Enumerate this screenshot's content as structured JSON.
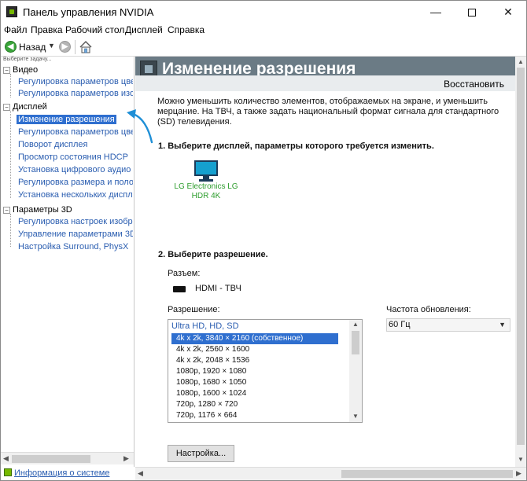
{
  "window": {
    "title": "Панель управления NVIDIA",
    "minimize_glyph": "—",
    "close_glyph": "✕"
  },
  "menu": [
    "Файл",
    "Правка",
    "Рабочий стол",
    "Дисплей",
    "Справка"
  ],
  "toolbar": {
    "back_label": "Назад",
    "back_glyph": "◀",
    "forward_glyph": "▶",
    "dropdown_glyph": "▼"
  },
  "sidebar": {
    "task_hint": "Выберите задачу...",
    "categories": [
      {
        "label": "Видео",
        "expand_glyph": "−",
        "items": [
          "Регулировка параметров цвета",
          "Регулировка параметров изображения"
        ]
      },
      {
        "label": "Дисплей",
        "expand_glyph": "−",
        "items": [
          "Изменение разрешения",
          "Регулировка параметров цвета",
          "Поворот дисплея",
          "Просмотр состояния HDCP",
          "Установка цифрового аудио",
          "Регулировка размера и положения",
          "Установка нескольких дисплеев"
        ]
      },
      {
        "label": "Параметры 3D",
        "expand_glyph": "−",
        "items": [
          "Регулировка настроек изображения",
          "Управление параметрами 3D",
          "Настройка Surround, PhysX"
        ]
      }
    ],
    "selected_item": "Изменение разрешения",
    "system_info": "Информация о системе",
    "scroll_left_glyph": "◀",
    "scroll_right_glyph": "▶"
  },
  "main": {
    "title": "Изменение разрешения",
    "restore_link": "Восстановить",
    "description": "Можно уменьшить количество элементов, отображаемых на экране, и уменьшить мерцание. На ТВЧ, а также задать национальный формат сигнала для стандартного (SD) телевидения.",
    "step1": "1. Выберите дисплей, параметры которого требуется изменить.",
    "display_name_line1": "LG Electronics LG",
    "display_name_line2": "HDR 4K",
    "step2": "2. Выберите разрешение.",
    "connector_label": "Разъем:",
    "connector_value": "HDMI - ТВЧ",
    "resolution_label": "Разрешение:",
    "refresh_label": "Частота обновления:",
    "refresh_value": "60 Гц",
    "resolution_group": "Ultra HD, HD, SD",
    "resolutions": [
      "4k x 2k, 3840 × 2160 (собственное)",
      "4k x 2k, 2560 × 1600",
      "4k x 2k, 2048 × 1536",
      "1080p, 1920 × 1080",
      "1080p, 1680 × 1050",
      "1080p, 1600 × 1024",
      "720p, 1280 × 720",
      "720p, 1176 × 664"
    ],
    "selected_resolution_index": 0,
    "setup_button": "Настройка...",
    "scroll_up_glyph": "▲",
    "scroll_down_glyph": "▼"
  },
  "colors": {
    "header_band": "#6b7b85",
    "link_blue": "#2a5db0",
    "selection": "#2f6fcf",
    "display_label_green": "#2d9d2d",
    "annotation_arrow": "#1f8fd6"
  },
  "icons": [
    "nvidia-app-icon",
    "back-arrow-icon",
    "forward-arrow-icon",
    "home-icon",
    "display-monitor-icon",
    "hdmi-connector-icon",
    "system-info-icon"
  ]
}
